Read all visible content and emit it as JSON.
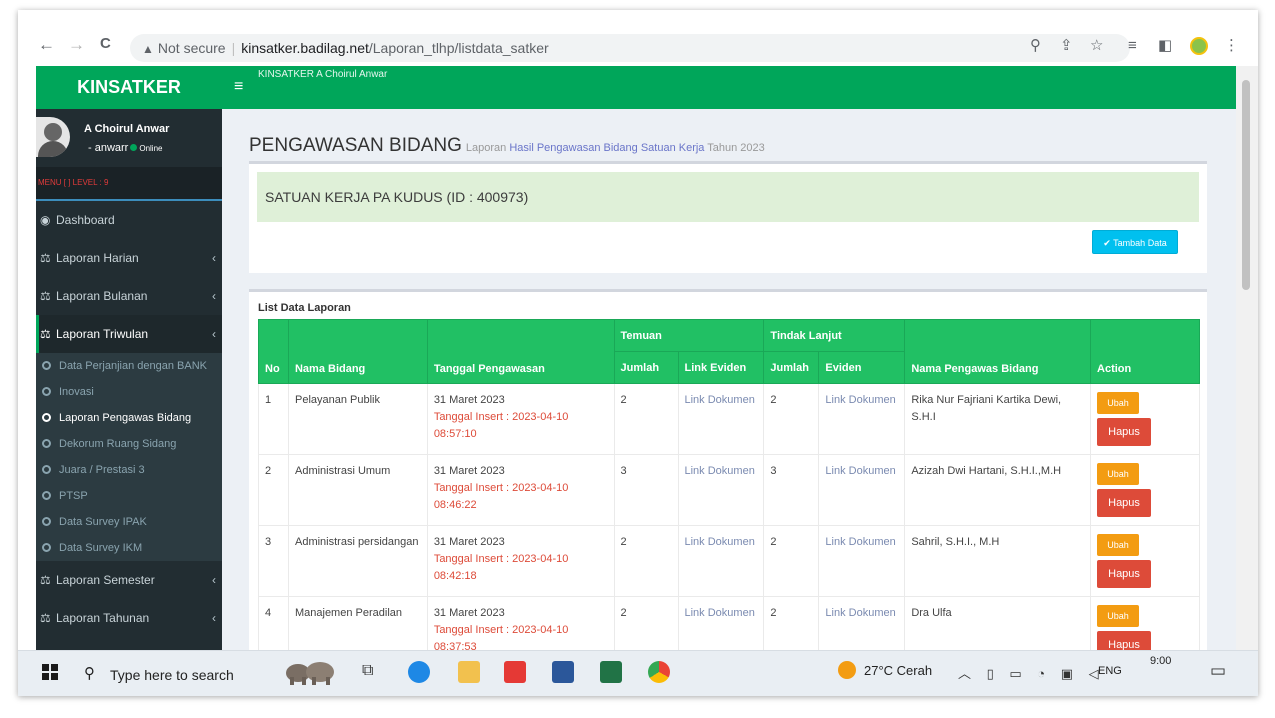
{
  "browser": {
    "back": "←",
    "forward": "→",
    "reload": "C",
    "not_secure": "Not secure",
    "separator": "|",
    "domain": "kinsatker.badilag.net",
    "path": "/Laporan_tlhp/listdata_satker"
  },
  "header": {
    "logo": "KINSATKER",
    "hamburger": "≡",
    "top_user": "KINSATKER A Choirul Anwar"
  },
  "user_panel": {
    "name": "A Choirul Anwar",
    "username": "- anwarr",
    "status": "Online"
  },
  "sidebar": {
    "menu_header": "MENU [ ] LEVEL : 9",
    "dashboard": "Dashboard",
    "harian": "Laporan Harian",
    "bulanan": "Laporan Bulanan",
    "triwulan": "Laporan Triwulan",
    "sub": [
      "Data Perjanjian dengan BANK",
      "Inovasi",
      "Laporan Pengawas Bidang",
      "Dekorum Ruang Sidang",
      "Juara / Prestasi 3",
      "PTSP",
      "Data Survey IPAK",
      "Data Survey IKM"
    ],
    "semester": "Laporan Semester",
    "tahunan": "Laporan Tahunan"
  },
  "page": {
    "title": "PENGAWASAN BIDANG",
    "sub_prefix": "Laporan",
    "sub_highlight": "Hasil Pengawasan Bidang Satuan Kerja",
    "sub_suffix": "Tahun 2023",
    "satker": "SATUAN KERJA PA KUDUS (ID : 400973)",
    "tambah": "Tambah Data",
    "list_title": "List Data Laporan"
  },
  "table": {
    "headers": {
      "no": "No",
      "nama_bidang": "Nama Bidang",
      "tanggal": "Tanggal Pengawasan",
      "temuan": "Temuan",
      "tindak_lanjut": "Tindak Lanjut",
      "jumlah": "Jumlah",
      "link_eviden": "Link Eviden",
      "jumlah2": "Jumlah",
      "eviden": "Eviden",
      "pengawas": "Nama Pengawas Bidang",
      "action": "Action"
    },
    "rows": [
      {
        "no": "1",
        "bidang": "Pelayanan Publik",
        "tanggal": "31 Maret 2023",
        "insert": "Tanggal Insert : 2023-04-10 08:57:10",
        "temuan": "2",
        "link": "Link Dokumen",
        "tindak": "2",
        "eviden": "Link Dokumen",
        "pengawas": "Rika Nur Fajriani Kartika Dewi, S.H.I",
        "ubah": "Ubah",
        "hapus": "Hapus"
      },
      {
        "no": "2",
        "bidang": "Administrasi Umum",
        "tanggal": "31 Maret 2023",
        "insert": "Tanggal Insert : 2023-04-10 08:46:22",
        "temuan": "3",
        "link": "Link Dokumen",
        "tindak": "3",
        "eviden": "Link Dokumen",
        "pengawas": "Azizah Dwi Hartani, S.H.I.,M.H",
        "ubah": "Ubah",
        "hapus": "Hapus"
      },
      {
        "no": "3",
        "bidang": "Administrasi persidangan",
        "tanggal": "31 Maret 2023",
        "insert": "Tanggal Insert : 2023-04-10 08:42:18",
        "temuan": "2",
        "link": "Link Dokumen",
        "tindak": "2",
        "eviden": "Link Dokumen",
        "pengawas": "Sahril, S.H.I., M.H",
        "ubah": "Ubah",
        "hapus": "Hapus"
      },
      {
        "no": "4",
        "bidang": "Manajemen Peradilan",
        "tanggal": "31 Maret 2023",
        "insert": "Tanggal Insert : 2023-04-10 08:37:53",
        "temuan": "2",
        "link": "Link Dokumen",
        "tindak": "2",
        "eviden": "Link Dokumen",
        "pengawas": "Dra Ulfa",
        "ubah": "Ubah",
        "hapus": "Hapus"
      }
    ]
  },
  "taskbar": {
    "search": "Type here to search",
    "weather": "27°C  Cerah",
    "lang": "ENG",
    "time": "9:00"
  },
  "colors": {
    "brand_green": "#00a65a",
    "table_header": "#21c064",
    "sidebar_bg": "#222d32",
    "danger": "#dd4b39",
    "warning": "#f39c12",
    "info": "#00c0ef"
  }
}
